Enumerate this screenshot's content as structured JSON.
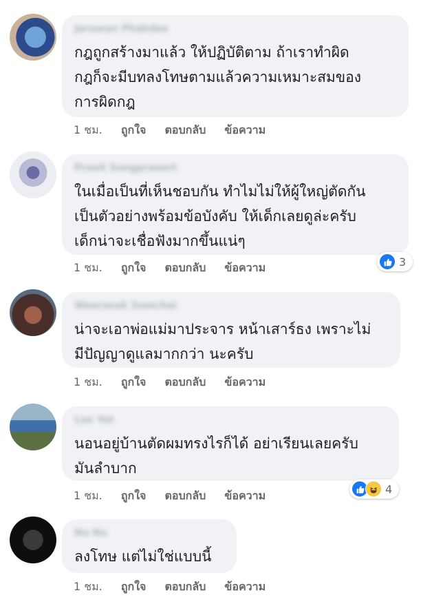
{
  "comments": [
    {
      "name": "Jaruwan Phakdee",
      "text": "กฎถูกสร้างมาแล้ว ให้ปฏิบัติตาม ถ้าเราทำผิด\nกฎก็จะมีบทลงโทษตามแล้วความเหมาะสมของ\nการผิดกฎ",
      "time": "1 ชม.",
      "like_label": "ถูกใจ",
      "reply_label": "ตอบกลับ",
      "message_label": "ข้อความ",
      "reaction_count": null,
      "avatar_colors": [
        "#2c4a8c",
        "#6fa4d8"
      ]
    },
    {
      "name": "Prasit Songprasert",
      "text": "ในเมื่อเป็นที่เห็นชอบกัน ทำไมไม่ให้ผู้ใหญ่ตัดกัน\nเป็นตัวอย่างพร้อมข้อบังคับ ให้เด็กเลยดูล่ะครับ\nเด็กน่าจะเชื่อฟังมากขึ้นแน่ๆ",
      "time": "1 ชม.",
      "like_label": "ถูกใจ",
      "reply_label": "ตอบกลับ",
      "message_label": "ข้อความ",
      "reaction_count": "3",
      "avatar_colors": [
        "#d9dbe8",
        "#6a6aa6"
      ]
    },
    {
      "name": "Weerasak Somchai",
      "text": "น่าจะเอาพ่อแม่มาประจาร หน้าเสาร์ธง เพราะไม่\nมีปัญญาดูแลมากกว่า นะครับ",
      "time": "1 ชม.",
      "like_label": "ถูกใจ",
      "reply_label": "ตอบกลับ",
      "message_label": "ข้อความ",
      "reaction_count": null,
      "avatar_colors": [
        "#4a2e2a",
        "#a0604a"
      ]
    },
    {
      "name": "Lee Yot",
      "text": "นอนอยู่บ้านตัดผมทรงไรก็ได้ อย่าเรียนเลยครับ\nมันลำบาก",
      "time": "1 ชม.",
      "like_label": "ถูกใจ",
      "reply_label": "ตอบกลับ",
      "message_label": "ข้อความ",
      "reaction_count": "4",
      "avatar_colors": [
        "#3e6fa8",
        "#9ab4c8"
      ]
    },
    {
      "name": "Nu Nu",
      "text": "ลงโทษ แต่ไม่ใช่แบบนี้",
      "time": "1 ชม.",
      "like_label": "ถูกใจ",
      "reply_label": "ตอบกลับ",
      "message_label": "ข้อความ",
      "reaction_count": null,
      "avatar_colors": [
        "#0e0e0e",
        "#3a3a3a"
      ]
    }
  ]
}
